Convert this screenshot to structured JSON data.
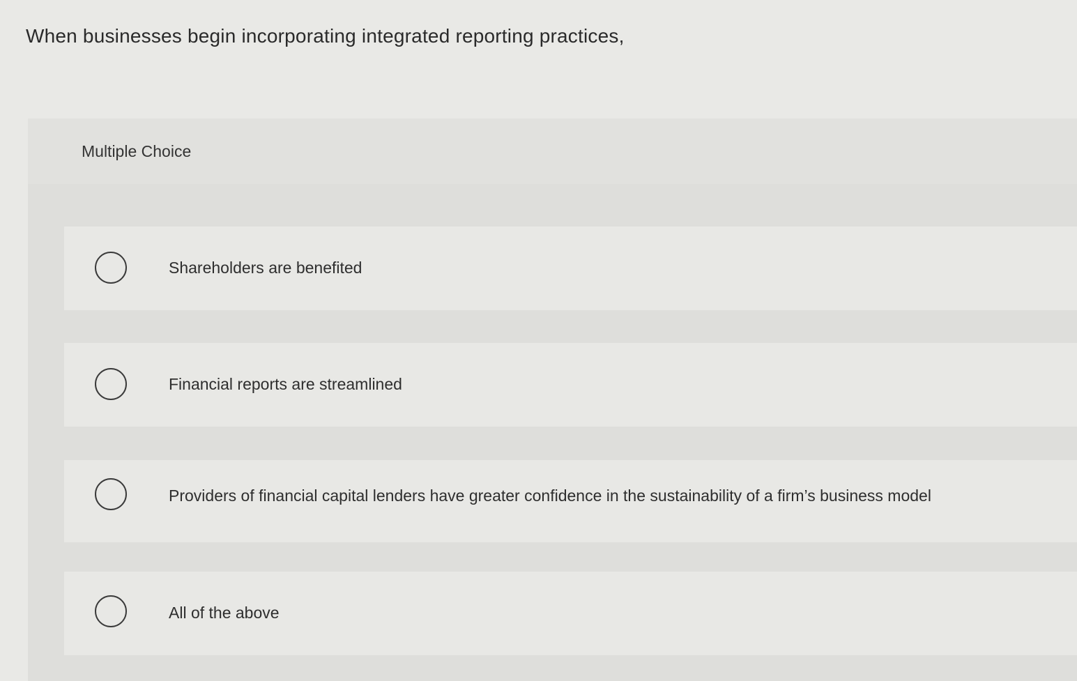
{
  "question": {
    "text": "When businesses begin incorporating integrated reporting practices,"
  },
  "panel": {
    "label": "Multiple Choice"
  },
  "options": [
    {
      "label": "Shareholders are benefited",
      "selected": false
    },
    {
      "label": "Financial reports are streamlined",
      "selected": false
    },
    {
      "label": "Providers of financial capital lenders have greater confidence in the sustainability of a firm’s business model",
      "selected": false
    },
    {
      "label": "All of the above",
      "selected": false
    }
  ]
}
